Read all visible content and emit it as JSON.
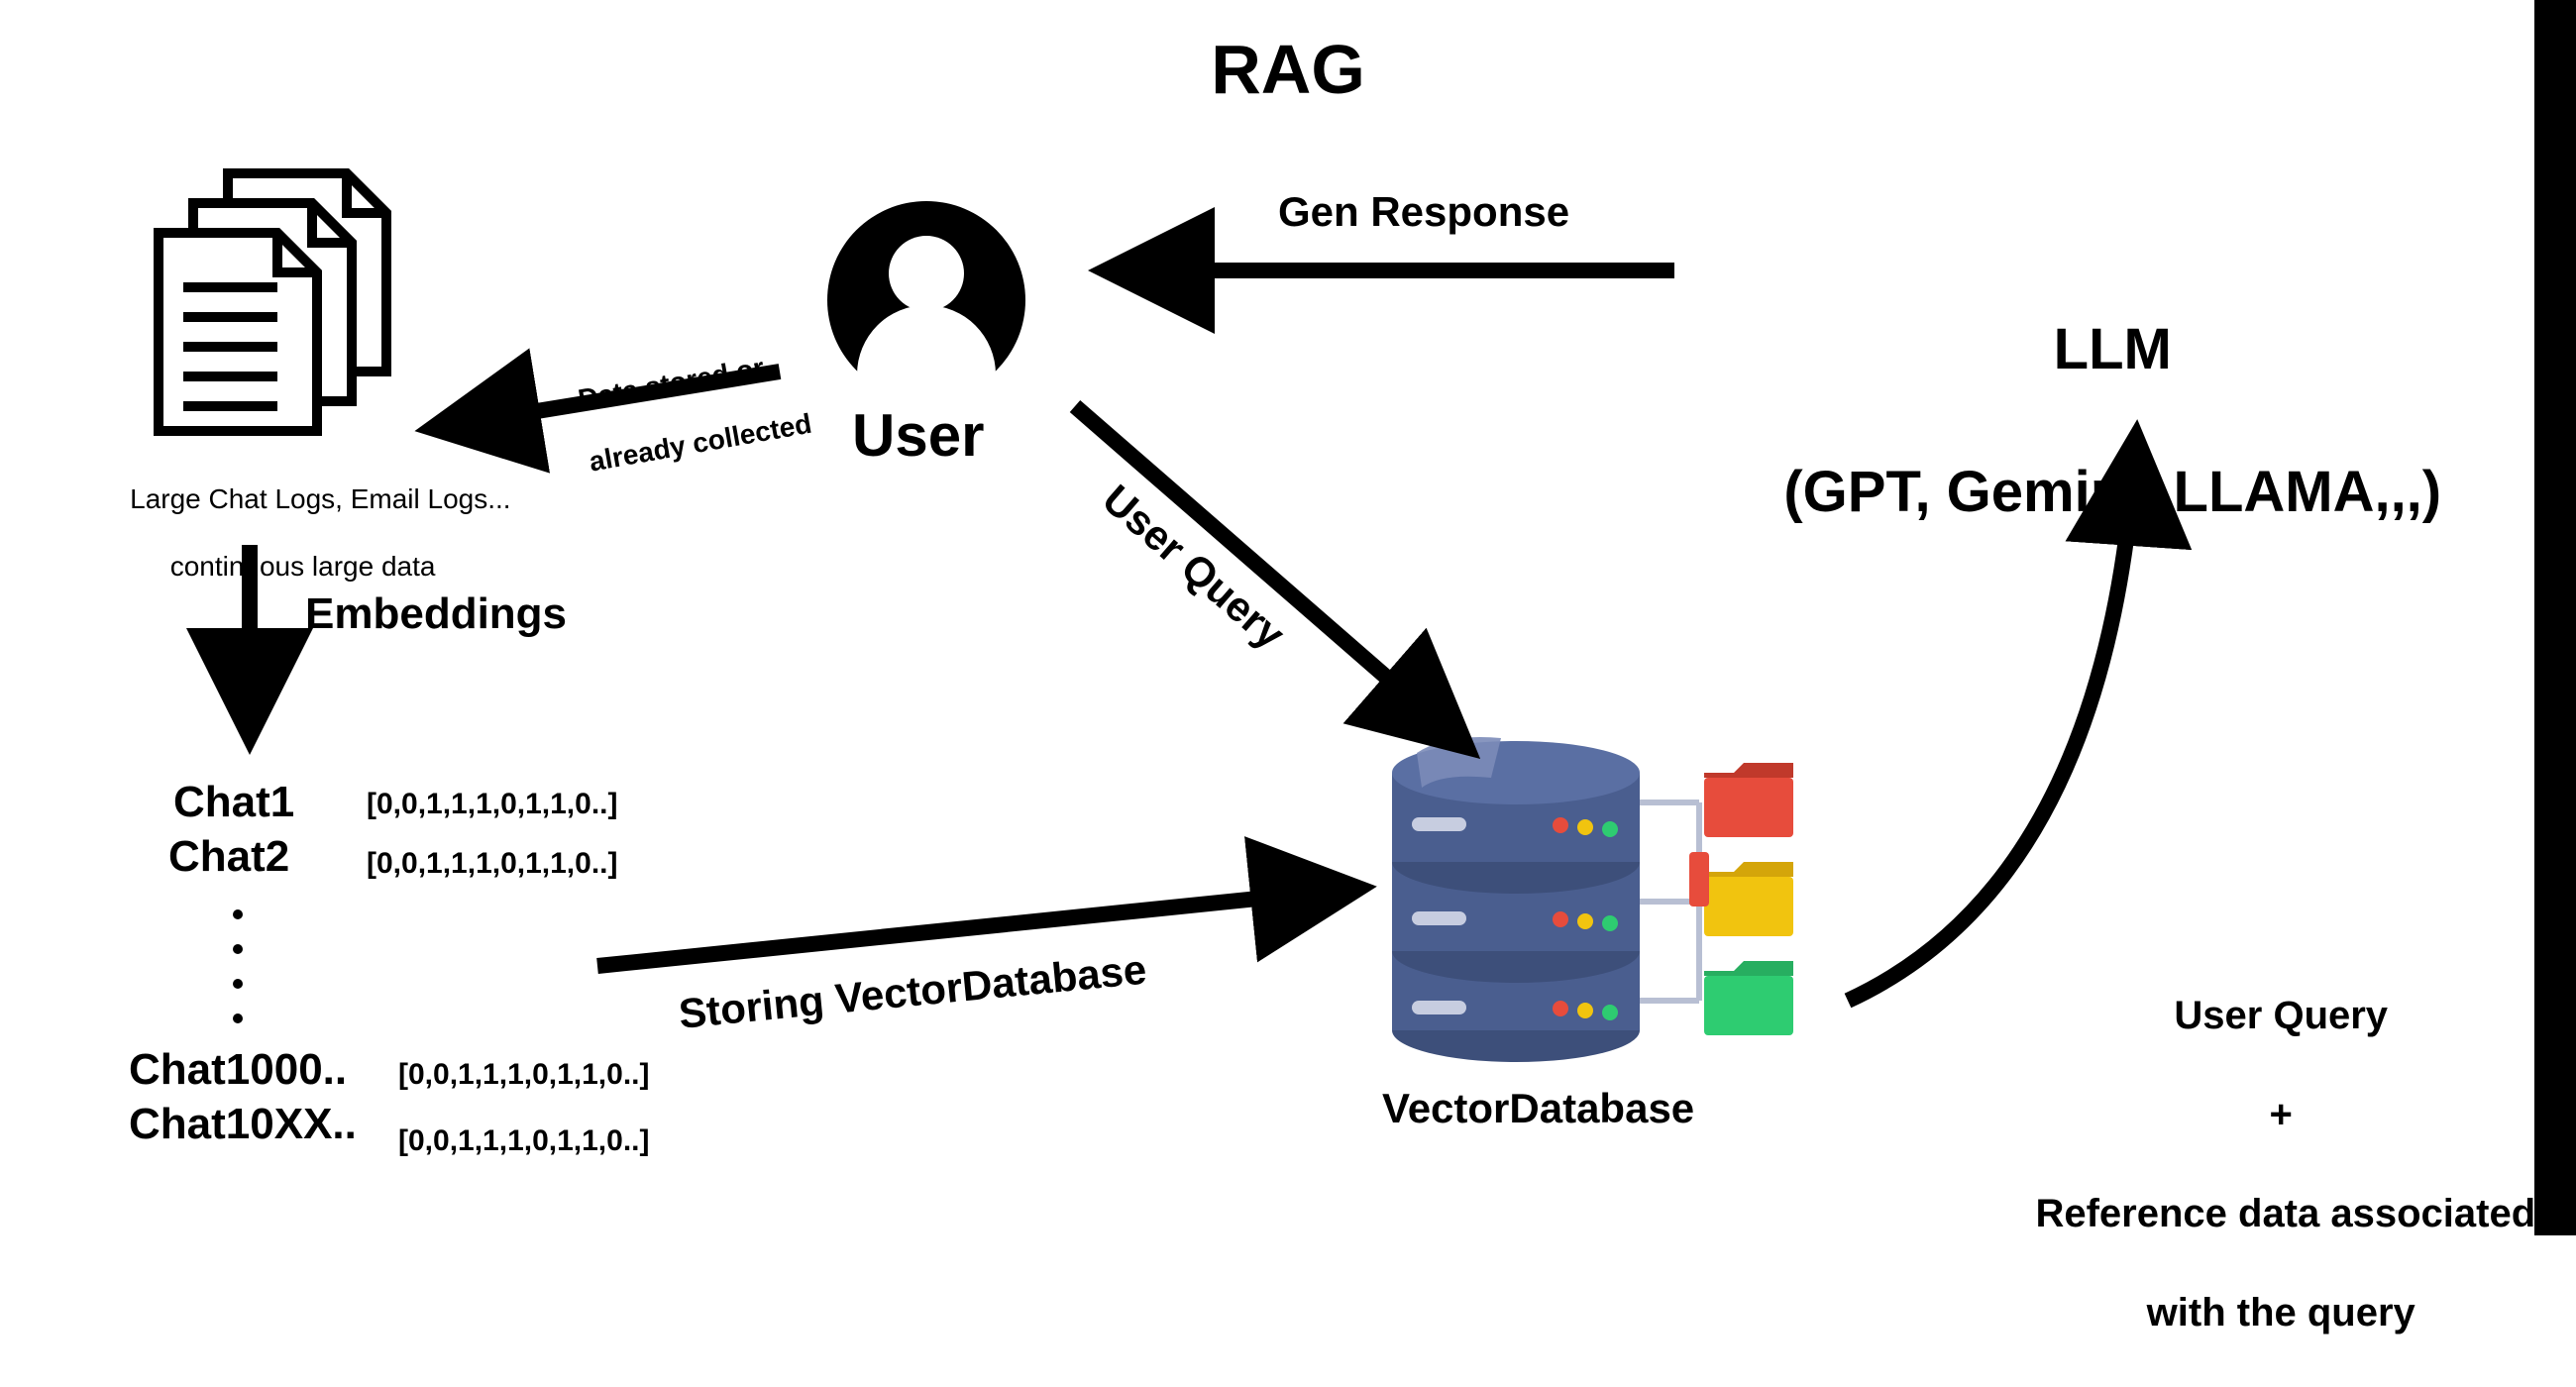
{
  "title": "RAG",
  "documents": {
    "caption_line1": "Large Chat Logs, Email Logs...",
    "caption_line2": "continuous large data"
  },
  "user": {
    "label": "User"
  },
  "llm": {
    "line1": "LLM",
    "line2": "(GPT, Gemini, LLAMA,,,)"
  },
  "vectordb": {
    "label": "VectorDatabase"
  },
  "embeddings": {
    "label": "Embeddings",
    "items": [
      {
        "name": "Chat1",
        "vector": "[0,0,1,1,1,0,1,1,0..]"
      },
      {
        "name": "Chat2",
        "vector": "[0,0,1,1,1,0,1,1,0..]"
      },
      {
        "name": "Chat1000..",
        "vector": "[0,0,1,1,1,0,1,1,0..]"
      },
      {
        "name": "Chat10XX..",
        "vector": "[0,0,1,1,1,0,1,1,0..]"
      }
    ]
  },
  "arrows": {
    "gen_response": "Gen Response",
    "data_stored_line1": "Data stored or",
    "data_stored_line2": "already collected",
    "user_query": "User Query",
    "storing": "Storing VectorDatabase",
    "augmented_line1": "User Query",
    "augmented_plus": "+",
    "augmented_line3": "Reference data associated",
    "augmented_line4": "with the query"
  }
}
